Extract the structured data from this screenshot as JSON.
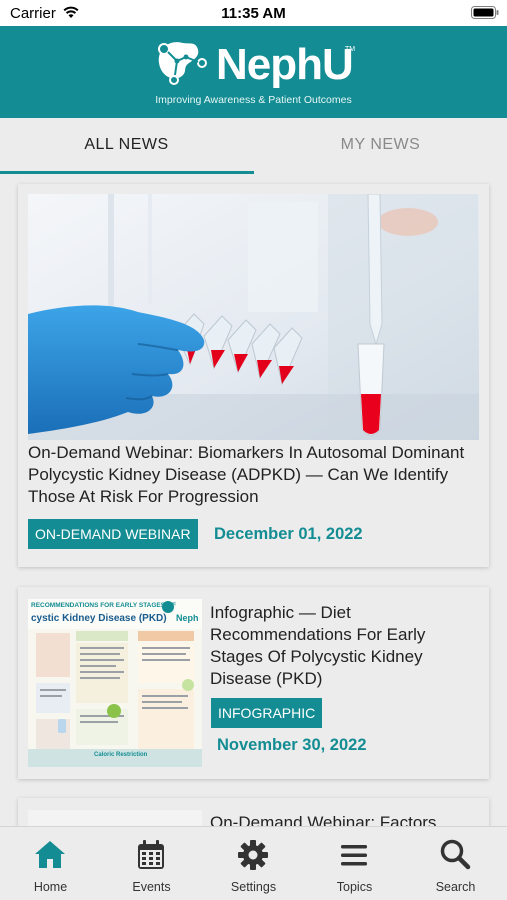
{
  "status_bar": {
    "carrier": "Carrier",
    "time": "11:35 AM"
  },
  "header": {
    "brand": "NephU",
    "trademark": "TM",
    "tagline": "Improving Awareness & Patient Outcomes"
  },
  "tabs": [
    {
      "label": "ALL NEWS",
      "active": true
    },
    {
      "label": "MY NEWS",
      "active": false
    }
  ],
  "feed": [
    {
      "title": "On-Demand Webinar: Biomarkers In Autosomal Dominant Polycystic Kidney Disease (ADPKD) — Can We Identify Those At Risk For Progression",
      "tag": "ON-DEMAND WEBINAR",
      "date": "December 01, 2022"
    },
    {
      "title": "Infographic — Diet Recommendations For Early Stages Of Polycystic Kidney Disease (PKD)",
      "tag": "INFOGRAPHIC",
      "date": "November 30, 2022",
      "thumbnail": {
        "heading_line1": "RECOMMENDATIONS FOR EARLY STAGES OF",
        "heading_line2": "cystic Kidney Disease (PKD)",
        "brand": "Neph",
        "footer": "Caloric Restriction"
      }
    },
    {
      "title": "On-Demand Webinar: Factors"
    }
  ],
  "bottom_nav": [
    {
      "label": "Home",
      "icon": "home-icon",
      "active": true
    },
    {
      "label": "Events",
      "icon": "calendar-icon",
      "active": false
    },
    {
      "label": "Settings",
      "icon": "gear-icon",
      "active": false
    },
    {
      "label": "Topics",
      "icon": "menu-icon",
      "active": false
    },
    {
      "label": "Search",
      "icon": "search-icon",
      "active": false
    }
  ],
  "colors": {
    "brand": "#138d93",
    "active_nav": "#138d93",
    "inactive_nav": "#333333"
  }
}
